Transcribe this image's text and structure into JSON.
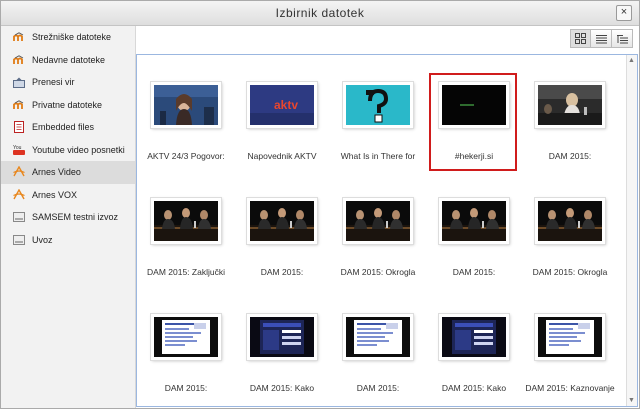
{
  "dialog": {
    "title": "Izbirnik datotek",
    "close_glyph": "×"
  },
  "sidebar": {
    "items": [
      {
        "label": "Strežniške datoteke",
        "icon": "moodle-icon"
      },
      {
        "label": "Nedavne datoteke",
        "icon": "moodle-icon"
      },
      {
        "label": "Prenesi vir",
        "icon": "upload-icon"
      },
      {
        "label": "Privatne datoteke",
        "icon": "moodle-icon"
      },
      {
        "label": "Embedded files",
        "icon": "document-icon"
      },
      {
        "label": "Youtube video posnetki",
        "icon": "youtube-icon"
      },
      {
        "label": "Arnes Video",
        "icon": "arnes-icon",
        "active": true
      },
      {
        "label": "Arnes VOX",
        "icon": "arnes-icon"
      },
      {
        "label": "SAMSEM testni izvoz",
        "icon": "drive-icon"
      },
      {
        "label": "Uvoz",
        "icon": "drive-icon"
      }
    ]
  },
  "toolbar": {
    "views": [
      "icons-view",
      "list-view",
      "tree-view"
    ],
    "selected_view": "icons-view"
  },
  "files": [
    {
      "label": "AKTV 24/3 Pogovor:",
      "thumb": "studio"
    },
    {
      "label": "Napovednik AKTV",
      "thumb": "aktv"
    },
    {
      "label": "What Is in There for",
      "thumb": "question"
    },
    {
      "label": "#hekerji.si",
      "thumb": "dark",
      "selected": true
    },
    {
      "label": "DAM 2015:",
      "thumb": "panel-light"
    },
    {
      "label": "DAM 2015: Zaključki",
      "thumb": "panel"
    },
    {
      "label": "DAM 2015:",
      "thumb": "panel"
    },
    {
      "label": "DAM 2015: Okrogla",
      "thumb": "panel"
    },
    {
      "label": "DAM 2015:",
      "thumb": "panel"
    },
    {
      "label": "DAM 2015: Okrogla",
      "thumb": "panel"
    },
    {
      "label": "DAM 2015:",
      "thumb": "slide"
    },
    {
      "label": "DAM 2015: Kako",
      "thumb": "slide-dark"
    },
    {
      "label": "DAM 2015:",
      "thumb": "slide"
    },
    {
      "label": "DAM 2015: Kako",
      "thumb": "slide-dark"
    },
    {
      "label": "DAM 2015: Kaznovanje",
      "thumb": "slide"
    }
  ],
  "thumb_text": {
    "aktv": "aktv"
  },
  "colors": {
    "selection": "#d01c1c",
    "accent": "#9bb7e0"
  }
}
